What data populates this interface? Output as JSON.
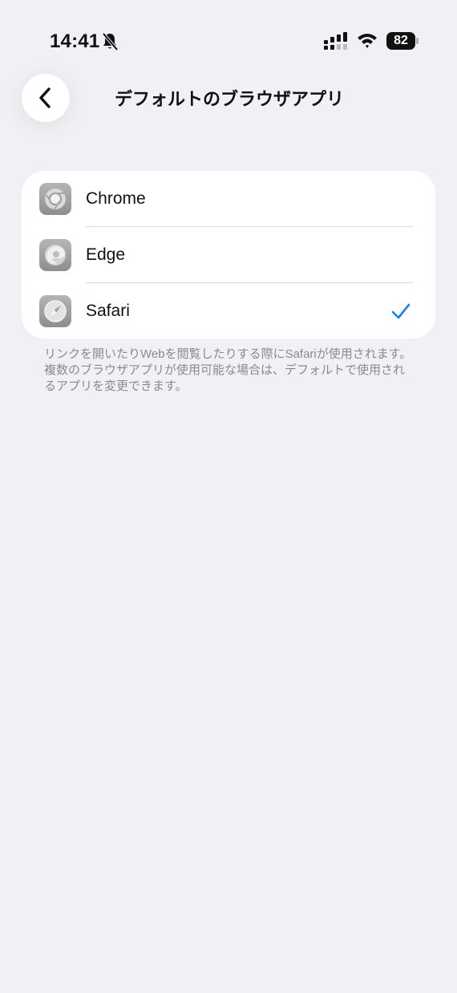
{
  "status_bar": {
    "time": "14:41",
    "battery": "82",
    "icons": [
      "bell-slash-icon",
      "signal-icon",
      "wifi-icon",
      "battery-icon"
    ]
  },
  "nav": {
    "back_icon": "chevron-left-icon",
    "title": "デフォルトのブラウザアプリ"
  },
  "browsers": [
    {
      "name": "Chrome",
      "icon": "chrome-icon",
      "selected": false
    },
    {
      "name": "Edge",
      "icon": "edge-icon",
      "selected": false
    },
    {
      "name": "Safari",
      "icon": "safari-icon",
      "selected": true
    }
  ],
  "footnote": "リンクを開いたりWebを閲覧したりする際にSafariが使用されます。複数のブラウザアプリが使用可能な場合は、デフォルトで使用されるアプリを変更できます。",
  "colors": {
    "background": "#f0f0f5",
    "card": "#ffffff",
    "accent": "#1a7ff0",
    "secondary_text": "#8a8a8e"
  }
}
